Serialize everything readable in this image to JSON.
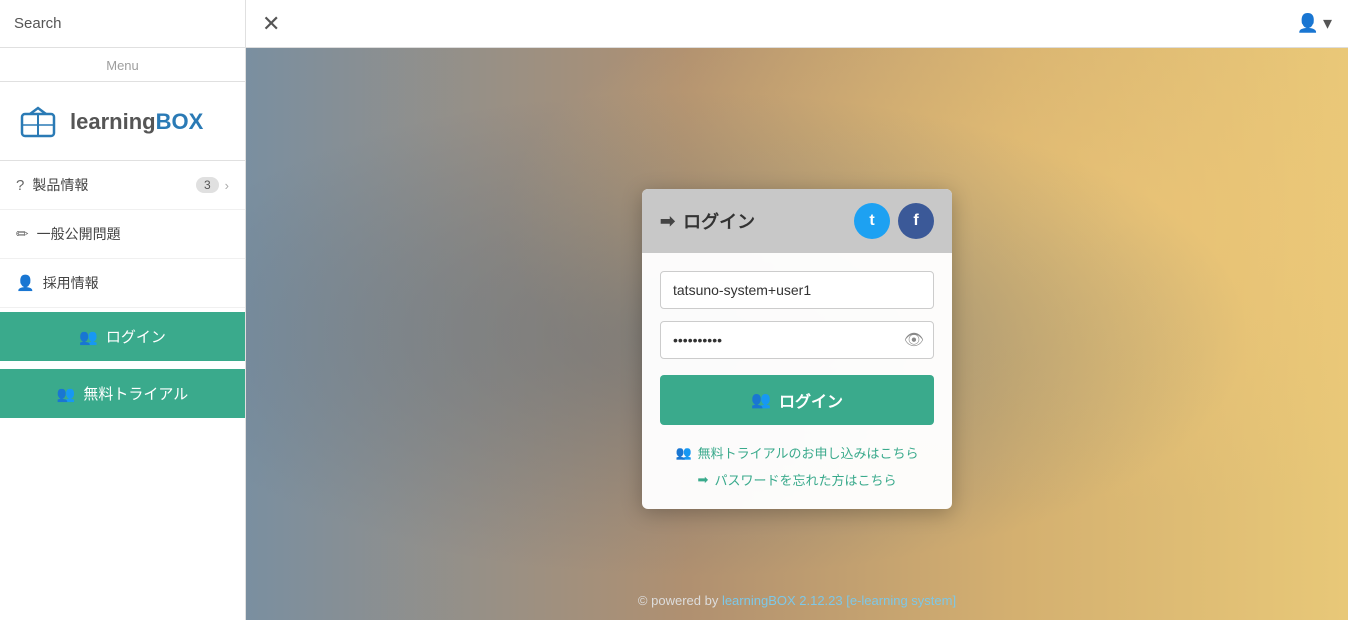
{
  "sidebar": {
    "search_label": "Search",
    "menu_label": "Menu",
    "logo": {
      "text_learning": "learning",
      "text_box": "BOX"
    },
    "nav_items": [
      {
        "id": "products",
        "icon": "?",
        "label": "製品情報",
        "badge": "3",
        "has_arrow": true
      },
      {
        "id": "public",
        "icon": "✏",
        "label": "一般公開問題",
        "badge": "",
        "has_arrow": false
      },
      {
        "id": "recruit",
        "icon": "👤",
        "label": "採用情報",
        "badge": "",
        "has_arrow": false
      }
    ],
    "btn_login_label": "ログイン",
    "btn_trial_label": "無料トライアル"
  },
  "topbar": {
    "close_label": "✕"
  },
  "login_card": {
    "header": {
      "title": "ログイン",
      "title_icon": "➡"
    },
    "social": {
      "twitter_label": "t",
      "facebook_label": "f"
    },
    "username_placeholder": "tatsuno-system+user1",
    "username_value": "tatsuno-system+user1",
    "password_value": "••••••••••",
    "password_placeholder": "",
    "btn_login_label": "ログイン",
    "link_trial": "無料トライアルのお申し込みはこちら",
    "link_password": "パスワードを忘れた方はこちら"
  },
  "footer": {
    "text": "© powered by ",
    "link_text": "learningBOX 2.12.23 [e-learning system]"
  }
}
